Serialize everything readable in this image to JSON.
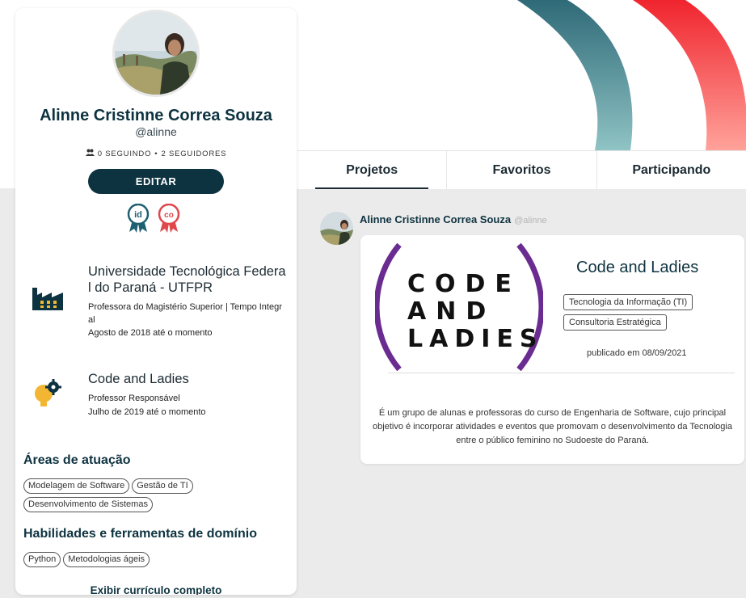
{
  "profile": {
    "name": "Alinne Cristinne Correa Souza",
    "handle": "@alinne",
    "following": "0 SEGUINDO",
    "separator": "•",
    "followers": "2 SEGUIDORES",
    "edit_label": "EDITAR",
    "badge_orcid": "id",
    "badge_co": "co"
  },
  "experiences": [
    {
      "icon": "factory-icon",
      "organization": "Universidade Tecnológica Federal do Paraná - UTFPR",
      "role": "Professora do Magistério Superior | Tempo Integral",
      "period": "Agosto de 2018 até o momento"
    },
    {
      "icon": "lightbulb-gear-icon",
      "organization": "Code and Ladies",
      "role": "Professor Responsável",
      "period": "Julho de 2019 até o momento"
    }
  ],
  "areas": {
    "title": "Áreas de atuação",
    "items": [
      "Modelagem de Software",
      "Gestão de TI",
      "Desenvolvimento de Sistemas"
    ]
  },
  "skills": {
    "title": "Habilidades e ferramentas de domínio",
    "items": [
      "Python",
      "Metodologias ágeis"
    ]
  },
  "full_cv_label": "Exibir currículo completo",
  "tabs": [
    {
      "label": "Projetos",
      "active": true
    },
    {
      "label": "Favoritos",
      "active": false
    },
    {
      "label": "Participando",
      "active": false
    }
  ],
  "post": {
    "author": "Alinne Cristinne Correa Souza",
    "author_handle": "@alinne",
    "logo_lines": [
      "CODE",
      "AND",
      "LADIES"
    ],
    "title": "Code and Ladies",
    "tags": [
      "Tecnologia da Informação (TI)",
      "Consultoria Estratégica"
    ],
    "published": "publicado em 08/09/2021",
    "description": "É um grupo de alunas e professoras do curso de Engenharia de Software, cujo principal objetivo é incorporar atividades e eventos que promovam o desenvolvimento da Tecnologia entre o público feminino no Sudoeste do Paraná."
  },
  "colors": {
    "primary": "#0e3340",
    "banner_teal": "#4e9aa3",
    "banner_red": "#f0474e",
    "logo_purple": "#6a2c91",
    "badge_orcid": "#1f5f72",
    "badge_co": "#e0464a",
    "icon_yellow": "#f2b632"
  }
}
